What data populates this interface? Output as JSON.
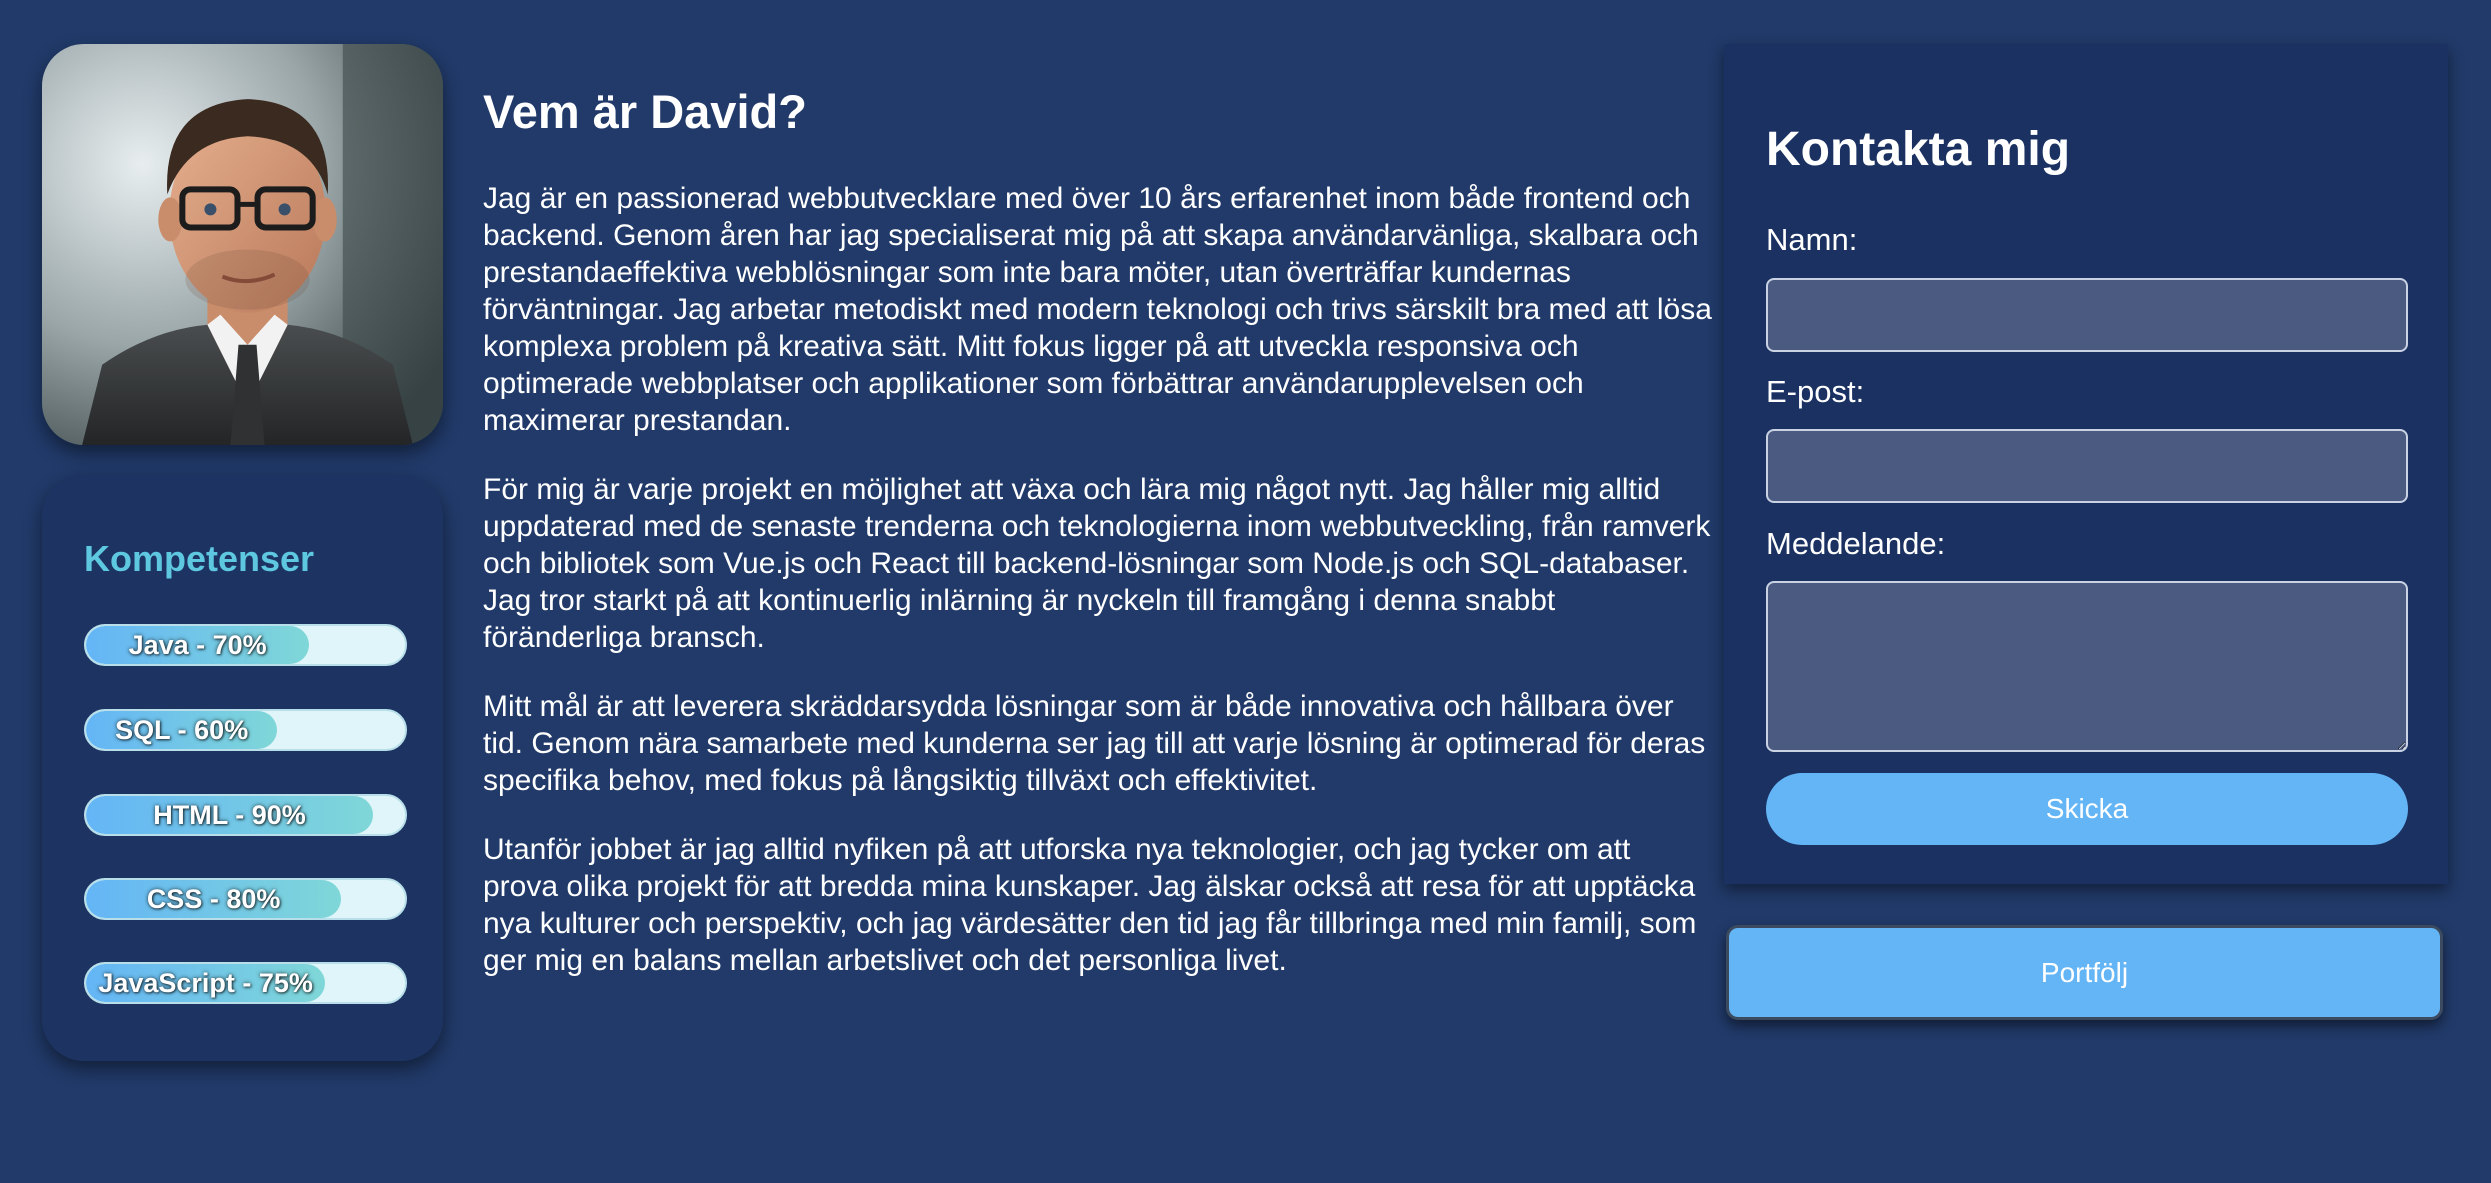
{
  "profile": {
    "portrait_alt": "Porträtt av David"
  },
  "skills": {
    "title": "Kompetenser",
    "items": [
      {
        "label": "Java - 70%",
        "level": 0.7
      },
      {
        "label": "SQL - 60%",
        "level": 0.6
      },
      {
        "label": "HTML - 90%",
        "level": 0.9
      },
      {
        "label": "CSS - 80%",
        "level": 0.8
      },
      {
        "label": "JavaScript - 75%",
        "level": 0.75
      }
    ]
  },
  "about": {
    "title": "Vem är David?",
    "paragraphs": [
      "Jag är en passionerad webbutvecklare med över 10 års erfarenhet inom både frontend och backend. Genom åren har jag specialiserat mig på att skapa användarvänliga, skalbara och prestandaeffektiva webblösningar som inte bara möter, utan överträffar kundernas förväntningar. Jag arbetar metodiskt med modern teknologi och trivs särskilt bra med att lösa komplexa problem på kreativa sätt. Mitt fokus ligger på att utveckla responsiva och optimerade webbplatser och applikationer som förbättrar användarupplevelsen och maximerar prestandan.",
      "För mig är varje projekt en möjlighet att växa och lära mig något nytt. Jag håller mig alltid uppdaterad med de senaste trenderna och teknologierna inom webbutveckling, från ramverk och bibliotek som Vue.js och React till backend-lösningar som Node.js och SQL-databaser. Jag tror starkt på att kontinuerlig inlärning är nyckeln till framgång i denna snabbt föränderliga bransch.",
      "Mitt mål är att leverera skräddarsydda lösningar som är både innovativa och hållbara över tid. Genom nära samarbete med kunderna ser jag till att varje lösning är optimerad för deras specifika behov, med fokus på långsiktig tillväxt och effektivitet.",
      "Utanför jobbet är jag alltid nyfiken på att utforska nya teknologier, och jag tycker om att prova olika projekt för att bredda mina kunskaper. Jag älskar också att resa för att upptäcka nya kulturer och perspektiv, och jag värdesätter den tid jag får tillbringa med min familj, som ger mig en balans mellan arbetslivet och det personliga livet."
    ]
  },
  "contact": {
    "title": "Kontakta mig",
    "name_label": "Namn:",
    "name_value": "",
    "email_label": "E-post:",
    "email_value": "",
    "message_label": "Meddelande:",
    "message_value": "",
    "submit_label": "Skicka"
  },
  "portfolio": {
    "label": "Portfölj"
  },
  "colors": {
    "background": "#213a69",
    "card": "#1d3463",
    "accent": "#64b5f6",
    "skills_title": "#5ec8e0",
    "skill_track": "#dff5f9"
  }
}
